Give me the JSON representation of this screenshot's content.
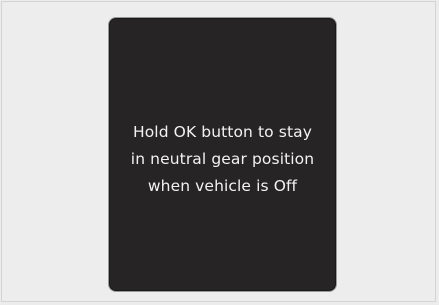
{
  "display": {
    "message_lines": [
      "Hold OK button to stay",
      "in neutral gear position",
      "when vehicle is Off"
    ]
  }
}
